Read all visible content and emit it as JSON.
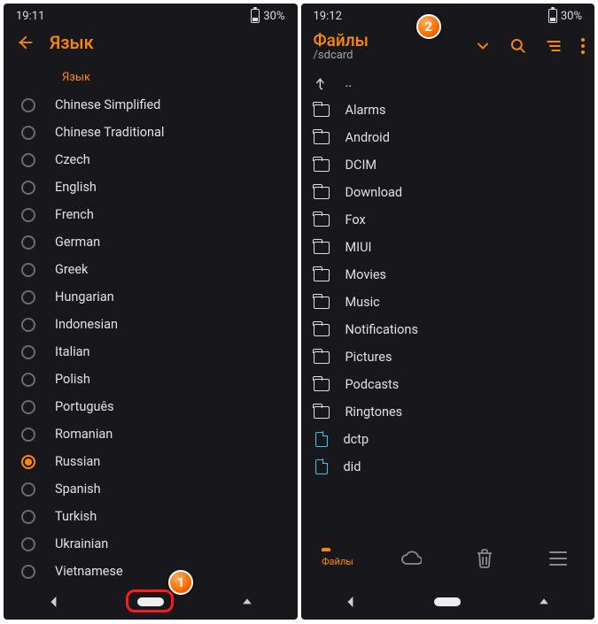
{
  "badges": {
    "one": "1",
    "two": "2"
  },
  "left": {
    "status": {
      "time": "19:11",
      "battery": "30%"
    },
    "appbar": {
      "title": "Язык"
    },
    "section_label": "Язык",
    "languages": [
      "Chinese Simplified",
      "Chinese Traditional",
      "Czech",
      "English",
      "French",
      "German",
      "Greek",
      "Hungarian",
      "Indonesian",
      "Italian",
      "Polish",
      "Português",
      "Romanian",
      "Russian",
      "Spanish",
      "Turkish",
      "Ukrainian",
      "Vietnamese"
    ],
    "selected_index": 13
  },
  "right": {
    "status": {
      "time": "19:12",
      "battery": "30%"
    },
    "appbar": {
      "title": "Файлы",
      "path": "/sdcard"
    },
    "up_label": "..",
    "entries": [
      {
        "type": "folder",
        "name": "Alarms"
      },
      {
        "type": "folder",
        "name": "Android"
      },
      {
        "type": "folder",
        "name": "DCIM"
      },
      {
        "type": "folder",
        "name": "Download"
      },
      {
        "type": "folder",
        "name": "Fox"
      },
      {
        "type": "folder",
        "name": "MIUI"
      },
      {
        "type": "folder",
        "name": "Movies"
      },
      {
        "type": "folder",
        "name": "Music"
      },
      {
        "type": "folder",
        "name": "Notifications"
      },
      {
        "type": "folder",
        "name": "Pictures"
      },
      {
        "type": "folder",
        "name": "Podcasts"
      },
      {
        "type": "folder",
        "name": "Ringtones"
      },
      {
        "type": "file",
        "name": "dctp"
      },
      {
        "type": "file",
        "name": "did"
      }
    ],
    "bottom_tabs": {
      "files_label": "Файлы"
    }
  }
}
